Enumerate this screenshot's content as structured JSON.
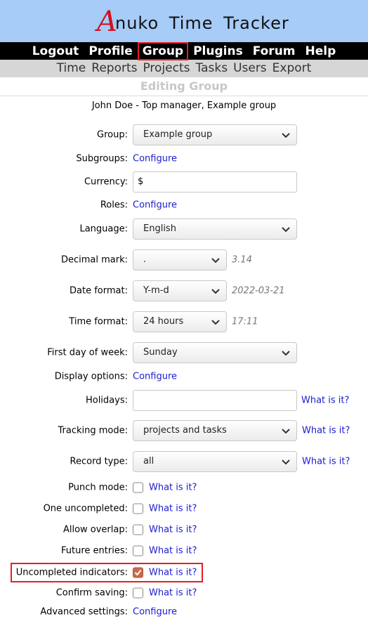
{
  "app": {
    "logo_letter": "A",
    "logo_rest": "nuko Time Tracker"
  },
  "topnav": [
    {
      "label": "Logout",
      "name": "logout"
    },
    {
      "label": "Profile",
      "name": "profile"
    },
    {
      "label": "Group",
      "name": "group",
      "active": true
    },
    {
      "label": "Plugins",
      "name": "plugins"
    },
    {
      "label": "Forum",
      "name": "forum"
    },
    {
      "label": "Help",
      "name": "help"
    }
  ],
  "subnav": [
    {
      "label": "Time",
      "name": "time"
    },
    {
      "label": "Reports",
      "name": "reports"
    },
    {
      "label": "Projects",
      "name": "projects"
    },
    {
      "label": "Tasks",
      "name": "tasks"
    },
    {
      "label": "Users",
      "name": "users"
    },
    {
      "label": "Export",
      "name": "export"
    }
  ],
  "page_title": "Editing Group",
  "user_line": "John Doe - Top manager, Example group",
  "form": {
    "group": {
      "label": "Group:",
      "value": "Example group"
    },
    "subgroups": {
      "label": "Subgroups:",
      "link": "Configure"
    },
    "currency": {
      "label": "Currency:",
      "value": "$"
    },
    "roles": {
      "label": "Roles:",
      "link": "Configure"
    },
    "language": {
      "label": "Language:",
      "value": "English"
    },
    "decimal_mark": {
      "label": "Decimal mark:",
      "value": ".",
      "hint": "3.14"
    },
    "date_format": {
      "label": "Date format:",
      "value": "Y-m-d",
      "hint": "2022-03-21"
    },
    "time_format": {
      "label": "Time format:",
      "value": "24 hours",
      "hint": "17:11"
    },
    "first_day": {
      "label": "First day of week:",
      "value": "Sunday"
    },
    "display_options": {
      "label": "Display options:",
      "link": "Configure"
    },
    "holidays": {
      "label": "Holidays:",
      "value": "",
      "what": "What is it?"
    },
    "tracking_mode": {
      "label": "Tracking mode:",
      "value": "projects and tasks",
      "what": "What is it?"
    },
    "record_type": {
      "label": "Record type:",
      "value": "all",
      "what": "What is it?"
    },
    "punch_mode": {
      "label": "Punch mode:",
      "checked": false,
      "what": "What is it?"
    },
    "one_uncompleted": {
      "label": "One uncompleted:",
      "checked": false,
      "what": "What is it?"
    },
    "allow_overlap": {
      "label": "Allow overlap:",
      "checked": false,
      "what": "What is it?"
    },
    "future_entries": {
      "label": "Future entries:",
      "checked": false,
      "what": "What is it?"
    },
    "uncompleted_indicators": {
      "label": "Uncompleted indicators:",
      "checked": true,
      "what": "What is it?"
    },
    "confirm_saving": {
      "label": "Confirm saving:",
      "checked": false,
      "what": "What is it?"
    },
    "advanced_settings": {
      "label": "Advanced settings:",
      "link": "Configure"
    }
  },
  "colors": {
    "header_bg": "#a6ccf7",
    "highlight": "#e51f24",
    "link": "#1a1ccd",
    "checkbox_checked": "#c96b4b"
  }
}
